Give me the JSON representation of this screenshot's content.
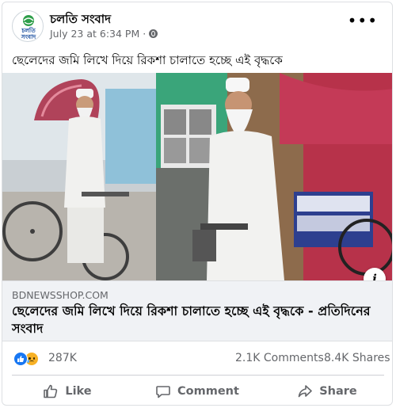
{
  "post": {
    "page_name": "চলতি সংবাদ",
    "timestamp": "July 23 at 6:34 PM",
    "separator": "·",
    "privacy_icon": "globe-icon",
    "more_icon": "more-options-icon",
    "more_label": "•••",
    "text": "ছেলেদের জমি লিখে দিয়ে রিকশা চালাতে হচ্ছে এই বৃদ্ধকে",
    "avatar_logo": {
      "line1": "চলতি",
      "line2": "সংবাদ"
    }
  },
  "link_preview": {
    "domain": "BDNEWSSHOP.COM",
    "title": "ছেলেদের জমি লিখে দিয়ে রিকশা চালাতে হচ্ছে এই বৃদ্ধকে - প্রতিদিনের সংবাদ",
    "info_label": "i"
  },
  "reactions": {
    "icons": [
      "like-reaction-icon",
      "sad-reaction-icon"
    ],
    "count": "287K",
    "comments": "2.1K Comments",
    "shares": "8.4K Shares"
  },
  "actions": {
    "like": "Like",
    "comment": "Comment",
    "share": "Share"
  },
  "colors": {
    "facebook_blue": "#1877f2",
    "secondary_text": "#65676b",
    "link_bg": "#f0f2f5"
  }
}
